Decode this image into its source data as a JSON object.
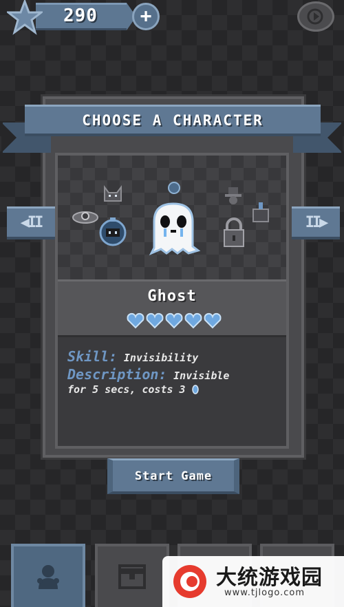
{
  "hud": {
    "coin_count": "290",
    "plus_label": "+",
    "icons": [
      "star-icon",
      "plus-icon",
      "exit-icon"
    ]
  },
  "panel": {
    "title": "CHOOSE A CHARACTER",
    "left_arrow": "◀II",
    "right_arrow": "II▶"
  },
  "character": {
    "name": "Ghost",
    "hearts": 5,
    "skill_label": "Skill:",
    "skill_value": "Invisibility",
    "description_label": "Description:",
    "description_value_1": "Invisible",
    "description_value_2": "for 5 secs, costs 3"
  },
  "actions": {
    "start_label": "Start Game"
  },
  "tabs": [
    "characters-tab",
    "shop-tab",
    "tab-3",
    "tab-4"
  ],
  "watermark": {
    "text": "大统游戏园",
    "url": "www.tjlogo.com"
  },
  "colors": {
    "accent_blue": "#5f7893",
    "heart_blue": "#6fa8e0",
    "label_blue": "#6f97c4",
    "background": "#262628"
  }
}
